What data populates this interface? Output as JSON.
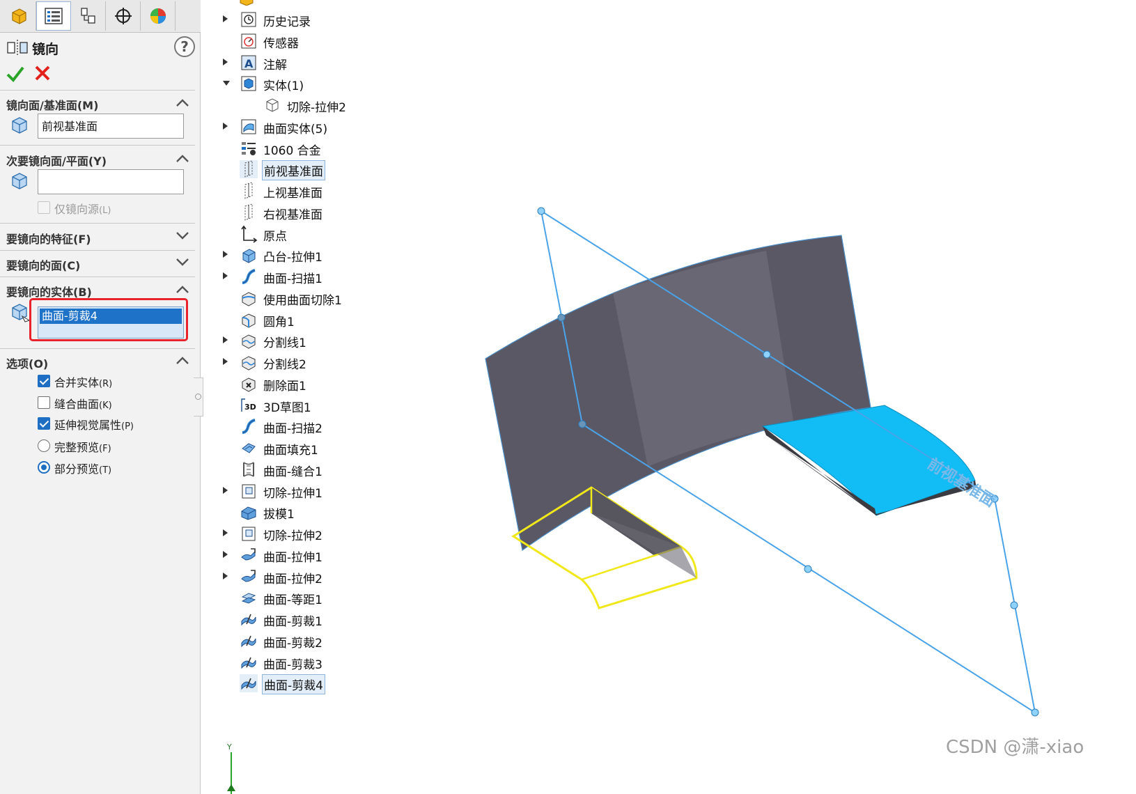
{
  "tabs": [
    {
      "name": "feature-manager"
    },
    {
      "name": "property-manager"
    },
    {
      "name": "configuration-manager"
    },
    {
      "name": "dimxpert-manager"
    },
    {
      "name": "display-manager"
    }
  ],
  "property_manager": {
    "title": "镜向",
    "help_label": "?",
    "mirror_face": {
      "heading": "镜向面/基准面(M)",
      "value": "前视基准面",
      "expanded": true
    },
    "secondary_mirror": {
      "heading": "次要镜向面/平面(Y)",
      "value": "",
      "mirror_source_only": {
        "label": "仅镜向源",
        "accel": "(L)",
        "checked": false,
        "enabled": false
      },
      "expanded": true
    },
    "features_to_mirror": {
      "heading": "要镜向的特征(F)",
      "expanded": false
    },
    "faces_to_mirror": {
      "heading": "要镜向的面(C)",
      "expanded": false
    },
    "bodies_to_mirror": {
      "heading": "要镜向的实体(B)",
      "items": [
        "曲面-剪裁4"
      ],
      "expanded": true
    },
    "options": {
      "heading": "选项(O)",
      "merge_solids": {
        "label": "合并实体",
        "accel": "(R)",
        "checked": true
      },
      "knit_surfaces": {
        "label": "缝合曲面",
        "accel": "(K)",
        "checked": false
      },
      "propagate_visual": {
        "label": "延伸视觉属性",
        "accel": "(P)",
        "checked": true
      },
      "full_preview": {
        "label": "完整预览",
        "accel": "(F)",
        "selected": false
      },
      "partial_preview": {
        "label": "部分预览",
        "accel": "(T)",
        "selected": true
      }
    }
  },
  "tree": [
    {
      "label": "历史记录",
      "icon": "history-icon",
      "arrow": "right"
    },
    {
      "label": "传感器",
      "icon": "sensor-icon",
      "arrow": ""
    },
    {
      "label": "注解",
      "icon": "annotation-icon",
      "arrow": "right"
    },
    {
      "label": "实体(1)",
      "icon": "solid-bodies-icon",
      "arrow": "down"
    },
    {
      "label": "切除-拉伸2",
      "icon": "body-icon",
      "arrow": "",
      "indent": true
    },
    {
      "label": "曲面实体(5)",
      "icon": "surface-bodies-icon",
      "arrow": "right"
    },
    {
      "label": "1060 合金",
      "icon": "material-icon",
      "arrow": ""
    },
    {
      "label": "前视基准面",
      "icon": "plane-icon",
      "arrow": "",
      "selected": true
    },
    {
      "label": "上视基准面",
      "icon": "plane-icon",
      "arrow": ""
    },
    {
      "label": "右视基准面",
      "icon": "plane-icon",
      "arrow": ""
    },
    {
      "label": "原点",
      "icon": "origin-icon",
      "arrow": ""
    },
    {
      "label": "凸台-拉伸1",
      "icon": "boss-extrude-icon",
      "arrow": "right"
    },
    {
      "label": "曲面-扫描1",
      "icon": "surface-sweep-icon",
      "arrow": "right"
    },
    {
      "label": "使用曲面切除1",
      "icon": "surface-cut-icon",
      "arrow": ""
    },
    {
      "label": "圆角1",
      "icon": "fillet-icon",
      "arrow": ""
    },
    {
      "label": "分割线1",
      "icon": "split-line-icon",
      "arrow": "right"
    },
    {
      "label": "分割线2",
      "icon": "split-line-icon",
      "arrow": "right"
    },
    {
      "label": "删除面1",
      "icon": "delete-face-icon",
      "arrow": ""
    },
    {
      "label": "3D草图1",
      "icon": "sketch-3d-icon",
      "arrow": ""
    },
    {
      "label": "曲面-扫描2",
      "icon": "surface-sweep-icon",
      "arrow": ""
    },
    {
      "label": "曲面填充1",
      "icon": "surface-fill-icon",
      "arrow": ""
    },
    {
      "label": "曲面-缝合1",
      "icon": "surface-knit-icon",
      "arrow": ""
    },
    {
      "label": "切除-拉伸1",
      "icon": "cut-extrude-icon",
      "arrow": "right"
    },
    {
      "label": "拔模1",
      "icon": "draft-icon",
      "arrow": ""
    },
    {
      "label": "切除-拉伸2",
      "icon": "cut-extrude-icon",
      "arrow": "right"
    },
    {
      "label": "曲面-拉伸1",
      "icon": "surface-extrude-icon",
      "arrow": "right"
    },
    {
      "label": "曲面-拉伸2",
      "icon": "surface-extrude-icon",
      "arrow": "right"
    },
    {
      "label": "曲面-等距1",
      "icon": "surface-offset-icon",
      "arrow": ""
    },
    {
      "label": "曲面-剪裁1",
      "icon": "surface-trim-icon",
      "arrow": ""
    },
    {
      "label": "曲面-剪裁2",
      "icon": "surface-trim-icon",
      "arrow": ""
    },
    {
      "label": "曲面-剪裁3",
      "icon": "surface-trim-icon",
      "arrow": ""
    },
    {
      "label": "曲面-剪裁4",
      "icon": "surface-trim-icon",
      "arrow": "",
      "selected": true
    }
  ],
  "viewport": {
    "plane_label": "前视基准面",
    "axis_label": "Y",
    "colors": {
      "plane_outline": "#4aa3e8",
      "preview": "#f0e81a",
      "highlight_body": "#12bdf5",
      "surface": "#5a5866"
    }
  },
  "watermark": "CSDN @潇-xiao"
}
